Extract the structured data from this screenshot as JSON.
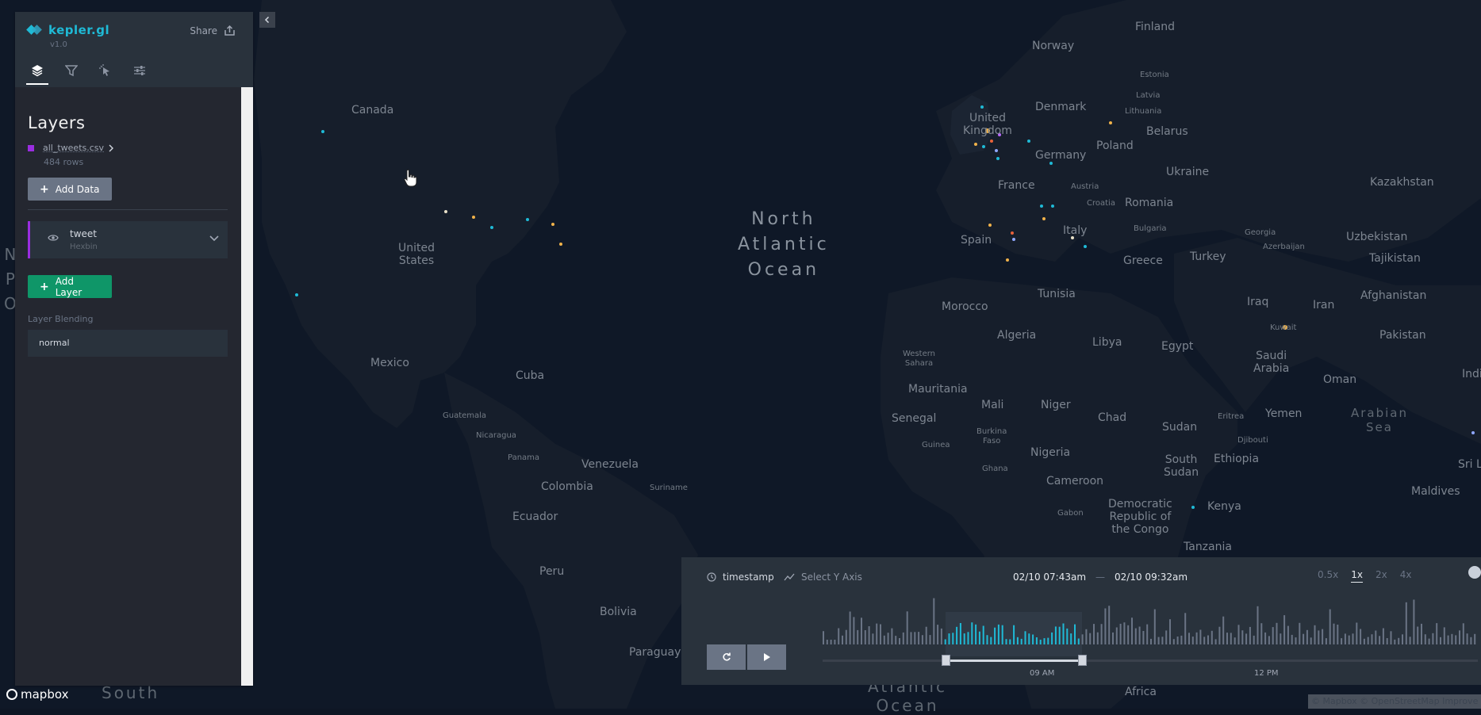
{
  "app": {
    "name": "kepler.gl",
    "version": "v1.0",
    "share_label": "Share"
  },
  "panel": {
    "tabs": [
      {
        "name": "layers",
        "icon": "layers-icon",
        "active": true
      },
      {
        "name": "filters",
        "icon": "filter-icon",
        "active": false
      },
      {
        "name": "interactions",
        "icon": "cursor-click-icon",
        "active": false
      },
      {
        "name": "map-style",
        "icon": "sliders-icon",
        "active": false
      }
    ],
    "section_title": "Layers",
    "dataset": {
      "name": "all_tweets.csv",
      "rows": "484 rows",
      "color": "#9a2de0"
    },
    "add_data_label": "Add Data",
    "layer": {
      "name": "tweet",
      "type": "Hexbin",
      "color": "#9a2de0"
    },
    "add_layer_label": "Add Layer",
    "blending_label": "Layer Blending",
    "blending_value": "normal"
  },
  "map": {
    "labels": [
      {
        "text": "Canada"
      },
      {
        "text": "United\nStates"
      },
      {
        "text": "Mexico"
      },
      {
        "text": "Cuba"
      },
      {
        "text": "Guatemala",
        "small": true
      },
      {
        "text": "Nicaragua",
        "small": true
      },
      {
        "text": "Panama",
        "small": true
      },
      {
        "text": "Venezuela"
      },
      {
        "text": "Colombia"
      },
      {
        "text": "Suriname",
        "small": true
      },
      {
        "text": "Ecuador"
      },
      {
        "text": "Peru"
      },
      {
        "text": "Bolivia"
      },
      {
        "text": "Paraguay"
      },
      {
        "text": "Finland"
      },
      {
        "text": "Norway"
      },
      {
        "text": "Estonia",
        "small": true
      },
      {
        "text": "Latvia",
        "small": true
      },
      {
        "text": "Lithuania",
        "small": true
      },
      {
        "text": "Denmark"
      },
      {
        "text": "United\nKingdom"
      },
      {
        "text": "Belarus"
      },
      {
        "text": "Poland"
      },
      {
        "text": "Germany"
      },
      {
        "text": "Ukraine"
      },
      {
        "text": "Kazakhstan"
      },
      {
        "text": "France"
      },
      {
        "text": "Austria",
        "small": true
      },
      {
        "text": "Croatia",
        "small": true
      },
      {
        "text": "Romania"
      },
      {
        "text": "Bulgaria",
        "small": true
      },
      {
        "text": "Italy"
      },
      {
        "text": "Spain"
      },
      {
        "text": "Georgia",
        "small": true
      },
      {
        "text": "Azerbaijan",
        "small": true
      },
      {
        "text": "Uzbekistan"
      },
      {
        "text": "Tajikistan"
      },
      {
        "text": "Greece"
      },
      {
        "text": "Turkey"
      },
      {
        "text": "Afghanistan"
      },
      {
        "text": "Morocco"
      },
      {
        "text": "Tunisia"
      },
      {
        "text": "Iraq"
      },
      {
        "text": "Iran"
      },
      {
        "text": "Pakistan"
      },
      {
        "text": "Algeria"
      },
      {
        "text": "Libya"
      },
      {
        "text": "Egypt"
      },
      {
        "text": "Kuwait",
        "small": true
      },
      {
        "text": "Western\nSahara",
        "small": true
      },
      {
        "text": "Saudi\nArabia"
      },
      {
        "text": "Oman"
      },
      {
        "text": "India"
      },
      {
        "text": "Mauritania"
      },
      {
        "text": "Mali"
      },
      {
        "text": "Niger"
      },
      {
        "text": "Senegal"
      },
      {
        "text": "Chad"
      },
      {
        "text": "Eritrea",
        "small": true
      },
      {
        "text": "Yemen"
      },
      {
        "text": "Sudan"
      },
      {
        "text": "Burkina\nFaso",
        "small": true
      },
      {
        "text": "Guinea",
        "small": true
      },
      {
        "text": "Nigeria"
      },
      {
        "text": "Djibouti",
        "small": true
      },
      {
        "text": "South\nSudan"
      },
      {
        "text": "Ethiopia"
      },
      {
        "text": "Ghana",
        "small": true
      },
      {
        "text": "Sri La"
      },
      {
        "text": "Cameroon"
      },
      {
        "text": "Maldives"
      },
      {
        "text": "Gabon",
        "small": true
      },
      {
        "text": "Democratic\nRepublic of\nthe Congo"
      },
      {
        "text": "Kenya"
      },
      {
        "text": "Tanzania"
      },
      {
        "text": "Africa"
      }
    ],
    "oceans": [
      {
        "text": "North\nAtlantic\nOcean"
      },
      {
        "text": "Arabian\nSea"
      },
      {
        "text": "Atlantic\nOcean"
      },
      {
        "text": "South"
      }
    ],
    "edge_letters": "N\nP\nO",
    "attribution": "© Mapbox © OpenStreetMap Improve",
    "mapbox_label": "mapbox"
  },
  "time_widget": {
    "field": "timestamp",
    "y_axis_placeholder": "Select Y Axis",
    "range_start": "02/10 07:43am",
    "range_end": "02/10 09:32am",
    "range_separator": "—",
    "speeds": [
      {
        "label": "0.5x",
        "active": false
      },
      {
        "label": "1x",
        "active": true
      },
      {
        "label": "2x",
        "active": false
      },
      {
        "label": "4x",
        "active": false
      }
    ],
    "ticks": [
      "09 AM",
      "12 PM"
    ],
    "histogram_color": "#6a7485",
    "histogram_selected_color": "#1fbad6"
  }
}
